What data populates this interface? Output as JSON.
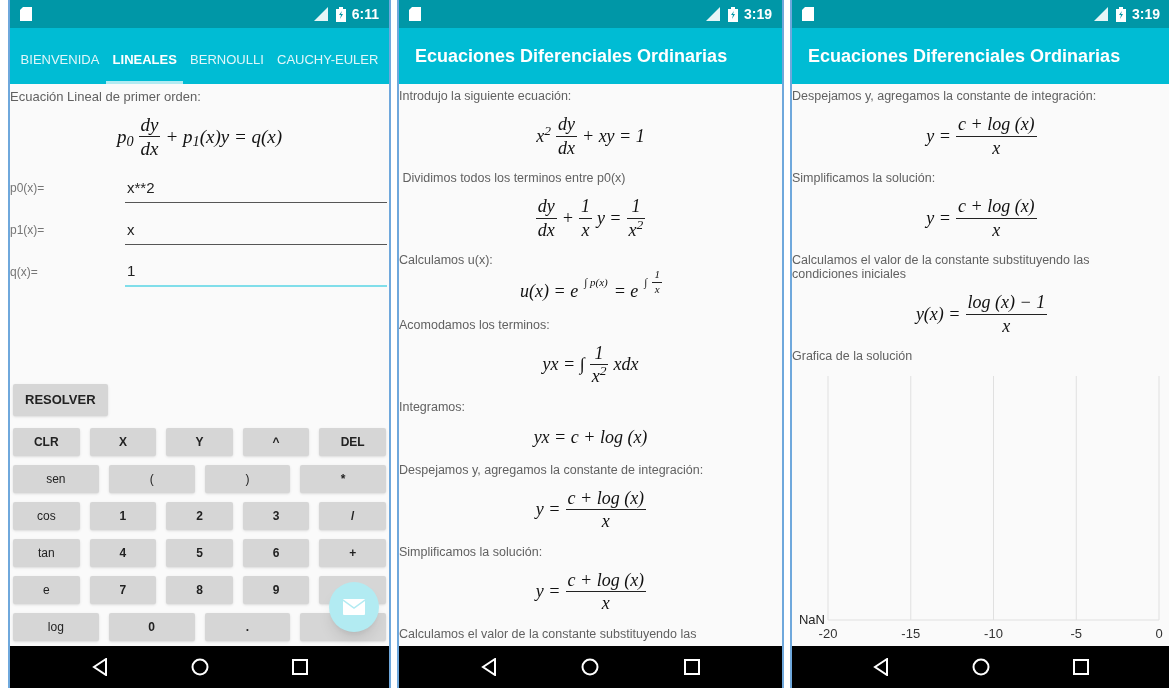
{
  "phones": [
    {
      "kind": "form",
      "status_bar": {
        "time": "6:11"
      },
      "tabs": [
        {
          "label": "BIENVENIDA",
          "selected": false
        },
        {
          "label": "LINEALES",
          "selected": true
        },
        {
          "label": "BERNOULLI",
          "selected": false
        },
        {
          "label": "CAUCHY-EULER",
          "selected": false
        }
      ],
      "heading": "Ecuación Lineal de primer orden:",
      "formula": [
        {
          "kind": "text",
          "text": "p$_{0}$"
        },
        {
          "kind": "frac",
          "num": "dy",
          "den": "dx"
        },
        {
          "kind": "text",
          "text": "+ p$_{1}$(x)y = q(x)"
        }
      ],
      "fields": [
        {
          "label": "p0(x)=",
          "value": "x**2",
          "focused": false
        },
        {
          "label": "p1(x)=",
          "value": "x",
          "focused": false
        },
        {
          "label": "q(x)=",
          "value": "1",
          "focused": true
        }
      ],
      "solve_button": "RESOLVER",
      "keypad": [
        [
          {
            "label": "CLR",
            "kind": "symbol"
          },
          {
            "label": "X",
            "kind": "symbol"
          },
          {
            "label": "Y",
            "kind": "symbol"
          },
          {
            "label": "^",
            "kind": "symbol"
          },
          {
            "label": "DEL",
            "kind": "symbol"
          }
        ],
        [
          {
            "label": "sen",
            "kind": "function"
          },
          {
            "label": "(",
            "kind": "function"
          },
          {
            "label": ")",
            "kind": "function"
          },
          {
            "label": "*",
            "kind": "symbol"
          }
        ],
        [
          {
            "label": "cos",
            "kind": "function"
          },
          {
            "label": "1",
            "kind": "symbol"
          },
          {
            "label": "2",
            "kind": "symbol"
          },
          {
            "label": "3",
            "kind": "symbol"
          },
          {
            "label": "/",
            "kind": "symbol"
          }
        ],
        [
          {
            "label": "tan",
            "kind": "function"
          },
          {
            "label": "4",
            "kind": "symbol"
          },
          {
            "label": "5",
            "kind": "symbol"
          },
          {
            "label": "6",
            "kind": "symbol"
          },
          {
            "label": "+",
            "kind": "symbol"
          }
        ],
        [
          {
            "label": "e",
            "kind": "function"
          },
          {
            "label": "7",
            "kind": "symbol"
          },
          {
            "label": "8",
            "kind": "symbol"
          },
          {
            "label": "9",
            "kind": "symbol"
          },
          {
            "kind": "symbol"
          }
        ],
        [
          {
            "label": "log",
            "kind": "function"
          },
          {
            "label": "0",
            "kind": "symbol"
          },
          {
            "label": ".",
            "kind": "symbol"
          },
          {
            "kind": "symbol"
          }
        ]
      ]
    },
    {
      "kind": "steps",
      "status_bar": {
        "time": "3:19"
      },
      "title": "Ecuaciones Diferenciales Ordinarias",
      "content": [
        {
          "kind": "text",
          "text": "Introdujo la siguiente ecuación:"
        },
        {
          "kind": "formula",
          "parts": [
            {
              "kind": "text",
              "text": "x$^{2}$"
            },
            {
              "kind": "frac",
              "num": "dy",
              "den": "dx"
            },
            {
              "kind": "text",
              "text": "+ xy = 1"
            }
          ]
        },
        {
          "kind": "text",
          "text": " Dividimos todos los terminos entre p0(x)"
        },
        {
          "kind": "formula",
          "parts": [
            {
              "kind": "frac",
              "num": "dy",
              "den": "dx"
            },
            {
              "kind": "text",
              "text": "+"
            },
            {
              "kind": "frac",
              "num": "1",
              "den": "x"
            },
            {
              "kind": "text",
              "text": "y ="
            },
            {
              "kind": "frac",
              "num": "1",
              "den": "x$^{2}$"
            }
          ]
        },
        {
          "kind": "text",
          "text": "Calculamos u(x):"
        },
        {
          "kind": "formula",
          "parts": [
            {
              "kind": "text",
              "text": "u(x) = e"
            },
            {
              "kind": "sup",
              "parts": [
                {
                  "kind": "text",
                  "text": "∫ p(x)"
                }
              ]
            },
            {
              "kind": "text",
              "text": "= e"
            },
            {
              "kind": "sup",
              "parts": [
                {
                  "kind": "text",
                  "text": "∫"
                },
                {
                  "kind": "frac",
                  "num": "1",
                  "den": "x"
                }
              ]
            }
          ]
        },
        {
          "kind": "text",
          "text": "Acomodamos los terminos:"
        },
        {
          "kind": "formula",
          "parts": [
            {
              "kind": "text",
              "text": "yx = ∫"
            },
            {
              "kind": "frac",
              "num": "1",
              "den": "x$^{2}$"
            },
            {
              "kind": "text",
              "text": "xdx"
            }
          ]
        },
        {
          "kind": "text",
          "text": "Integramos:"
        },
        {
          "kind": "formula",
          "parts": [
            {
              "kind": "text",
              "text": "yx = c + log (x)"
            }
          ]
        },
        {
          "kind": "text",
          "text": "Despejamos y, agregamos la constante de integración:"
        },
        {
          "kind": "formula",
          "parts": [
            {
              "kind": "text",
              "text": "y ="
            },
            {
              "kind": "frac",
              "num": "c + log (x)",
              "den": "x"
            }
          ]
        },
        {
          "kind": "text",
          "text": "Simplificamos la solución:"
        },
        {
          "kind": "formula",
          "parts": [
            {
              "kind": "text",
              "text": "y ="
            },
            {
              "kind": "frac",
              "num": "c + log (x)",
              "den": "x"
            }
          ]
        },
        {
          "kind": "text",
          "text": "Calculamos el valor de la constante substituyendo las"
        }
      ]
    },
    {
      "kind": "steps",
      "status_bar": {
        "time": "3:19"
      },
      "title": "Ecuaciones Diferenciales Ordinarias",
      "content": [
        {
          "kind": "text",
          "text": "Despejamos y, agregamos la constante de integración:"
        },
        {
          "kind": "formula",
          "parts": [
            {
              "kind": "text",
              "text": "y ="
            },
            {
              "kind": "frac",
              "num": "c + log (x)",
              "den": "x"
            }
          ]
        },
        {
          "kind": "text",
          "text": "Simplificamos la solución:"
        },
        {
          "kind": "formula",
          "parts": [
            {
              "kind": "text",
              "text": "y ="
            },
            {
              "kind": "frac",
              "num": "c + log (x)",
              "den": "x"
            }
          ]
        },
        {
          "kind": "text",
          "text": "Calculamos el valor de la constante substituyendo las condiciones iniciales"
        },
        {
          "kind": "formula",
          "parts": [
            {
              "kind": "text",
              "text": "y(x) ="
            },
            {
              "kind": "frac",
              "num": "log (x) − 1",
              "den": "x"
            }
          ]
        },
        {
          "kind": "text",
          "text": "Grafica de la solución"
        },
        {
          "kind": "chart",
          "corner_label": "NaN",
          "x_labels": [
            "-20",
            "-15",
            "-10",
            "-5",
            "0"
          ]
        }
      ]
    }
  ]
}
